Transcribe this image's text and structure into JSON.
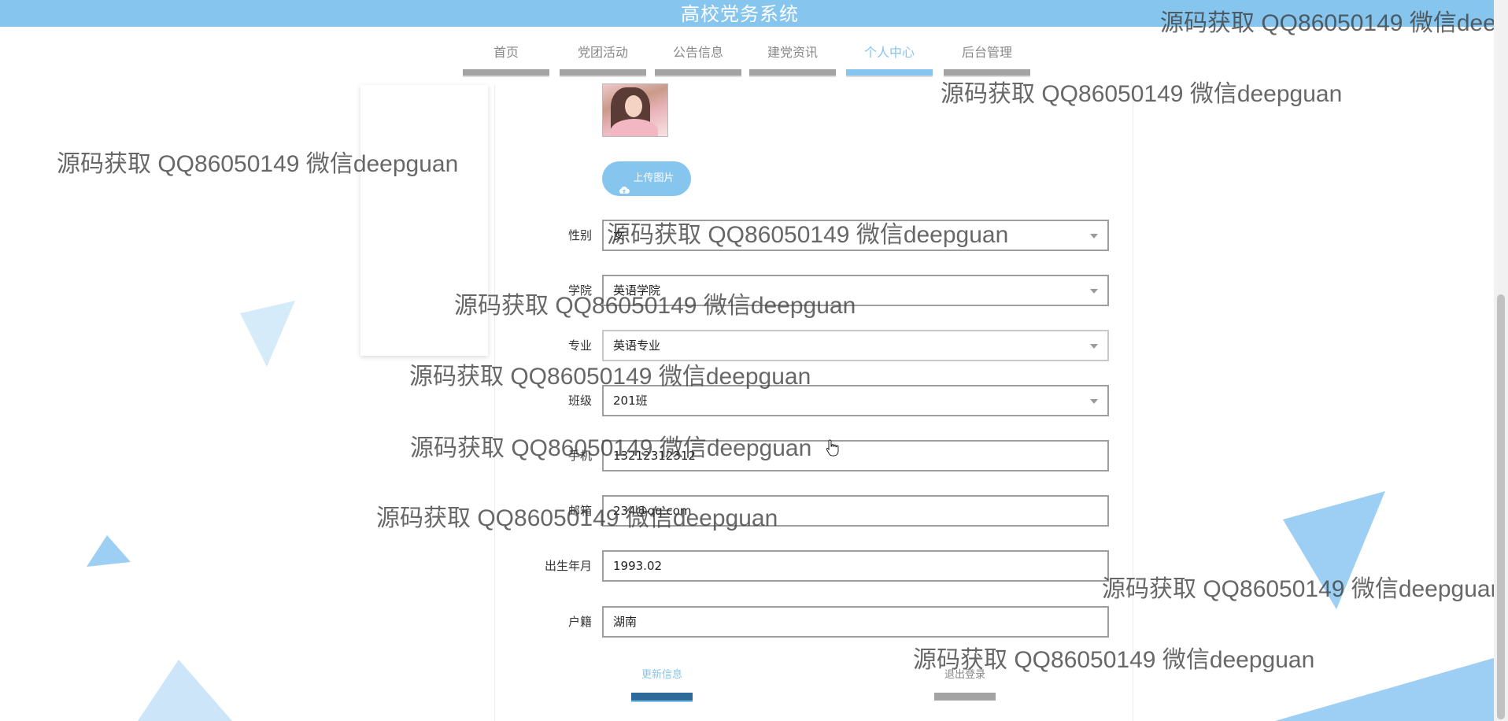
{
  "header": {
    "title": "高校党务系统"
  },
  "nav": {
    "items": [
      {
        "label": "首页",
        "active": false
      },
      {
        "label": "党团活动",
        "active": false
      },
      {
        "label": "公告信息",
        "active": false
      },
      {
        "label": "建党资讯",
        "active": false
      },
      {
        "label": "个人中心",
        "active": true
      },
      {
        "label": "后台管理",
        "active": false
      }
    ]
  },
  "profile": {
    "upload_label": "上传图片",
    "fields": {
      "gender": {
        "label": "性别",
        "value": "女"
      },
      "college": {
        "label": "学院",
        "value": "英语学院"
      },
      "major": {
        "label": "专业",
        "value": "英语专业"
      },
      "class": {
        "label": "班级",
        "value": "201班"
      },
      "phone": {
        "label": "手机",
        "value": "13212312312"
      },
      "email": {
        "label": "邮箱",
        "value": "234@qq.com"
      },
      "birth": {
        "label": "出生年月",
        "value": "1993.02"
      },
      "hometown": {
        "label": "户籍",
        "value": "湖南"
      }
    }
  },
  "actions": {
    "update_label": "更新信息",
    "logout_label": "退出登录"
  },
  "watermark": {
    "text": "源码获取 QQ86050149 微信deepguan"
  },
  "colors": {
    "accent": "#86c5ee",
    "nav_bar": "#a3a3a3",
    "update_bar": "#2d6a9a"
  }
}
